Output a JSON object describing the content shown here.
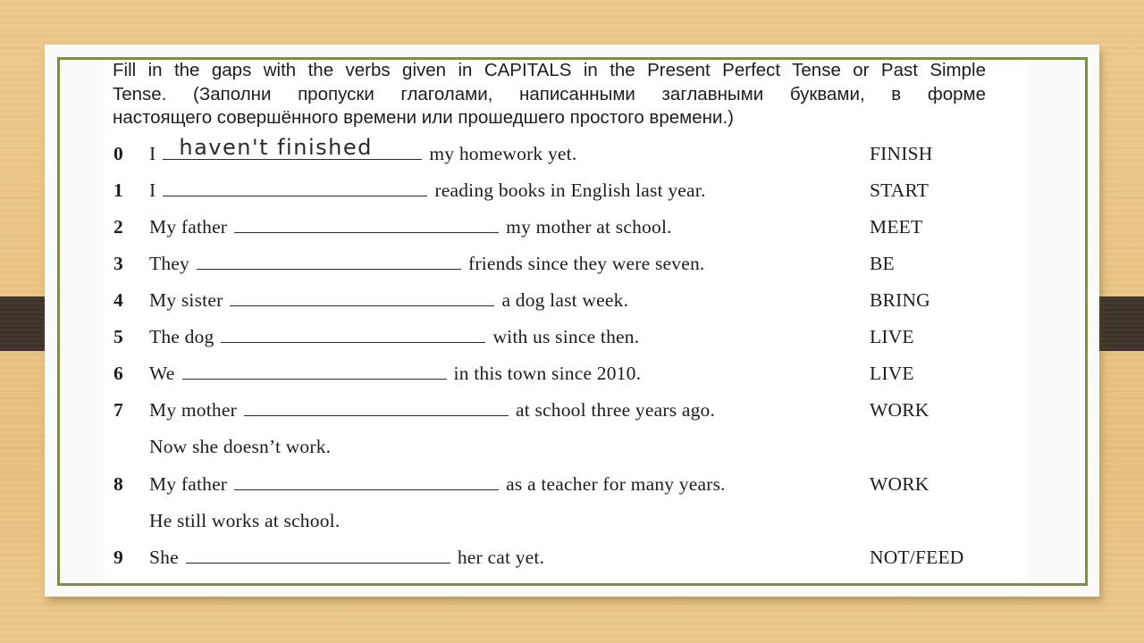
{
  "instructions": {
    "line1": "Fill in the gaps with the verbs given in CAPITALS in the Present Perfect Tense or Past Simple",
    "line2": "Tense. (Заполни пропуски глаголами, написанными заглавными буквами, в форме",
    "line3": "настоящего совершённого времени или прошедшего простого времени.)"
  },
  "exercises": [
    {
      "number": "0",
      "before": "I",
      "answer": "haven't finished",
      "after": "my homework yet.",
      "verb": "FINISH"
    },
    {
      "number": "1",
      "before": "I",
      "answer": "",
      "after": "reading books in English last year.",
      "verb": "START"
    },
    {
      "number": "2",
      "before": "My father",
      "answer": "",
      "after": "my mother at school.",
      "verb": "MEET"
    },
    {
      "number": "3",
      "before": "They",
      "answer": "",
      "after": "friends since they were seven.",
      "verb": "BE"
    },
    {
      "number": "4",
      "before": "My sister",
      "answer": "",
      "after": "a dog last week.",
      "verb": "BRING"
    },
    {
      "number": "5",
      "before": "The dog",
      "answer": "",
      "after": "with us since then.",
      "verb": "LIVE"
    },
    {
      "number": "6",
      "before": "We",
      "answer": "",
      "after": "in this town since 2010.",
      "verb": "LIVE"
    },
    {
      "number": "7",
      "before": "My mother",
      "answer": "",
      "after": "at school three years ago.",
      "verb": "WORK",
      "continuation": "Now she doesn’t work."
    },
    {
      "number": "8",
      "before": "My father",
      "answer": "",
      "after": "as a teacher for many years.",
      "verb": "WORK",
      "continuation": "He still works at school."
    },
    {
      "number": "9",
      "before": "She",
      "answer": "",
      "after": "her cat yet.",
      "verb": "NOT/FEED"
    }
  ],
  "colors": {
    "frame": "#7d8c48",
    "background_wood": "#e9c585",
    "tab": "#3f342b"
  }
}
